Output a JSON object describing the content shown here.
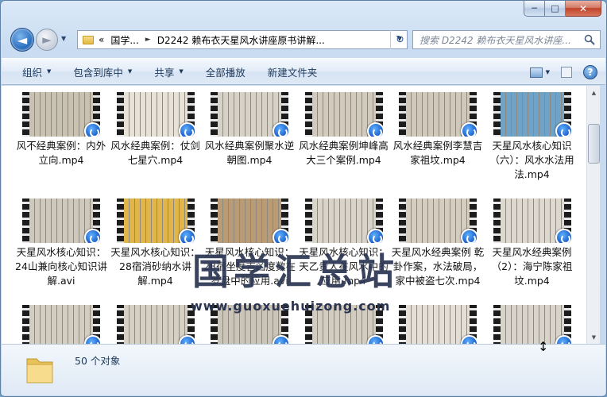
{
  "window": {
    "min_label": "─",
    "max_label": "□",
    "close_label": "✕"
  },
  "nav": {
    "back_label": "◄",
    "forward_label": "►",
    "history_label": "▼",
    "breadcrumb_prefix": "«",
    "crumbs": [
      "国学...",
      "D2242 赖布衣天星风水讲座原书讲解..."
    ],
    "crumb_sep": "►",
    "dropdown_label": "▼",
    "refresh_label": "↻",
    "search_placeholder": "搜索 D2242 赖布衣天星风水讲座..."
  },
  "toolbar": {
    "items": [
      {
        "label": "组织",
        "has_dropdown": true
      },
      {
        "label": "包含到库中",
        "has_dropdown": true
      },
      {
        "label": "共享",
        "has_dropdown": true
      },
      {
        "label": "全部播放",
        "has_dropdown": false
      },
      {
        "label": "新建文件夹",
        "has_dropdown": false
      }
    ],
    "dropdown_glyph": "▼",
    "view_dropdown": "▼",
    "help_label": "?"
  },
  "files": [
    {
      "name": "风不经典案例：内外立向.mp4",
      "thumb": "#c9c2b3"
    },
    {
      "name": "风水经典案例：仗剑七星穴.mp4",
      "thumb": "#e6e2d8"
    },
    {
      "name": "风水经典案例聚水逆朝图.mp4",
      "thumb": "#d7d2c7"
    },
    {
      "name": "风水经典案例坤峰高大三个案例.mp4",
      "thumb": "#d1cabd"
    },
    {
      "name": "风水经典案例李慧吉家祖坟.mp4",
      "thumb": "#cfc8bb"
    },
    {
      "name": "天星风水核心知识（六）：风水水法用法.mp4",
      "thumb": "#6fa3c8"
    },
    {
      "name": "天星风水核心知识：24山兼向核心知识讲解.avi",
      "thumb": "#cfc9bd"
    },
    {
      "name": "天星风水核心知识：28宿消砂纳水讲解.mp4",
      "thumb": "#e0b54a"
    },
    {
      "name": "天星风水核心知识：28宿坐度吉凶度数在罗盘中的应用.avi",
      "thumb": "#b99b75"
    },
    {
      "name": "天星风水核心知识：天乙贵人在风水中的应用.mp4",
      "thumb": "#d9d4ca"
    },
    {
      "name": "天星风水经典案例 乾卦作案，水法破局，家中被盗七次.mp4",
      "thumb": "#d4cdc0"
    },
    {
      "name": "天星风水经典案例（2）：海宁陈家祖坟.mp4",
      "thumb": "#ddd9d0"
    },
    {
      "name": "",
      "thumb": "#d3cdc2"
    },
    {
      "name": "",
      "thumb": "#d6d0c4"
    },
    {
      "name": "",
      "thumb": "#cbc5b9"
    },
    {
      "name": "",
      "thumb": "#d2ccc1"
    },
    {
      "name": "",
      "thumb": "#e3dfd6"
    },
    {
      "name": "",
      "thumb": "#d8d4cb"
    }
  ],
  "watermark": {
    "title": "国学汇总站",
    "url": "www.guoxuehuizong.com"
  },
  "scroll": {
    "up": "▲",
    "down": "▼"
  },
  "status": {
    "count": "50 个对象",
    "cursor": "↕"
  }
}
